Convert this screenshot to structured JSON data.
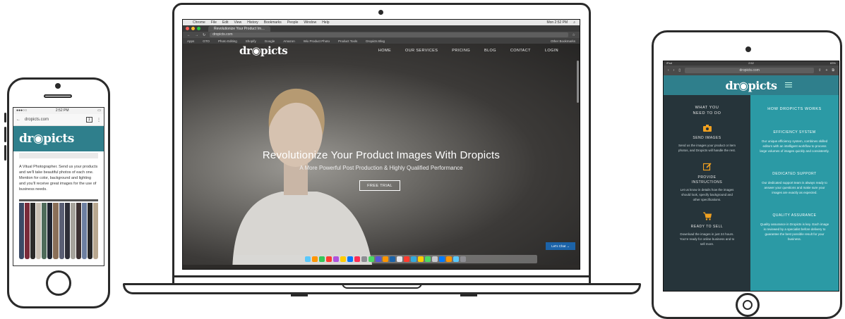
{
  "brand": {
    "logo": "dr◉picts",
    "accent": "#2f7f8c",
    "teal": "#2b9aa5"
  },
  "phone": {
    "status_time": "2:52 PM",
    "url": "dropicts.com",
    "tab_count": "1",
    "body_text": "A Vitual Photographer. Send us your products and we'll take beautiful photos of each one. Mention for color, background and lighting and you'll receive great images for the use of business needs."
  },
  "laptop": {
    "menubar": [
      "Chrome",
      "File",
      "Edit",
      "View",
      "History",
      "Bookmarks",
      "People",
      "Window",
      "Help"
    ],
    "menubar_right": "Mon 2:52 PM",
    "tab_title": "Revolutionize Your Product Im…",
    "url": "dropicts.com",
    "bookmarks": [
      "Apps",
      "GTO",
      "Photo Editing",
      "Shopify",
      "Google",
      "Amazon",
      "Wix Product Photo",
      "Product Tools",
      "Dropicts Blog",
      "Other Bookmarks"
    ],
    "nav_links": [
      "HOME",
      "OUR SERVICES",
      "PRICING",
      "BLOG",
      "CONTACT",
      "LOGIN"
    ],
    "hero_title": "Revolutionize Your Product Images With Dropicts",
    "hero_subtitle": "A More Powerful Post Production & Highly Qualified Performance",
    "cta": "FREE TRIAL",
    "chat": "Let's Chat →"
  },
  "tablet": {
    "status_left": "iPad",
    "status_time": "2:52",
    "status_right": "83%",
    "url": "dropicts.com",
    "left_heading": "WHAT YOU NEED TO DO",
    "steps": [
      {
        "icon": "camera-icon",
        "title": "SEND IMAGES",
        "text": "Send us the images your product or item photos, and Dropicts will handle the rest."
      },
      {
        "icon": "edit-icon",
        "title": "PROVIDE INSTRUCTIONS",
        "text": "Let us know in details how the images should look, specify background and other specifications."
      },
      {
        "icon": "cart-icon",
        "title": "READY TO SELL",
        "text": "Download the images in just 24 hours. You're ready for online business and to sell more."
      }
    ],
    "right_heading": "HOW DROPICTS WORKS",
    "features": [
      {
        "title": "EFFICIENCY SYSTEM",
        "text": "Our unique efficiency system, combines skilled editors with an intelligent workflow to process large volumes of images quickly and consistently."
      },
      {
        "title": "DEDICATED SUPPORT",
        "text": "Our dedicated support team is always ready to answer your questions and make sure your images are exactly as expected."
      },
      {
        "title": "QUALITY ASSURANCE",
        "text": "Quality assurance in Dropicts is key. Each image is reviewed by a specialist before delivery to guarantee the best possible result for your business."
      }
    ]
  }
}
